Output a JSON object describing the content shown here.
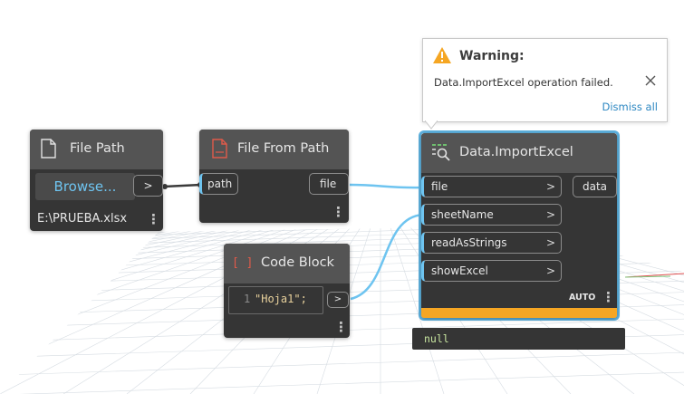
{
  "nodes": {
    "file_path": {
      "title": "File Path",
      "browse_label": "Browse...",
      "output_arrow": ">",
      "path_value": "E:\\PRUEBA.xlsx",
      "menu_glyph": "⋮"
    },
    "file_from_path": {
      "title": "File From Path",
      "input_label": "path",
      "output_label": "file",
      "menu_glyph": "⋮"
    },
    "import_excel": {
      "title": "Data.ImportExcel",
      "inputs": [
        {
          "label": "file",
          "arrow": ">"
        },
        {
          "label": "sheetName",
          "arrow": ">"
        },
        {
          "label": "readAsStrings",
          "arrow": ">"
        },
        {
          "label": "showExcel",
          "arrow": ">"
        }
      ],
      "output_label": "data",
      "lacing": "AUTO",
      "menu_glyph": "⋮",
      "preview_value": "null",
      "status_color": "#f5a623"
    },
    "code_block": {
      "title": "Code Block",
      "icon_glyph": "[ ]",
      "line_number": "1",
      "code": "\"Hoja1\";",
      "output_arrow": ">",
      "menu_glyph": "⋮"
    }
  },
  "warning": {
    "title": "Warning:",
    "message": "Data.ImportExcel operation failed.",
    "dismiss_label": "Dismiss all",
    "close_icon": "close-icon"
  },
  "colors": {
    "accent": "#6ec4f0",
    "selection": "#5fb3e0",
    "warning": "#f5a623"
  }
}
